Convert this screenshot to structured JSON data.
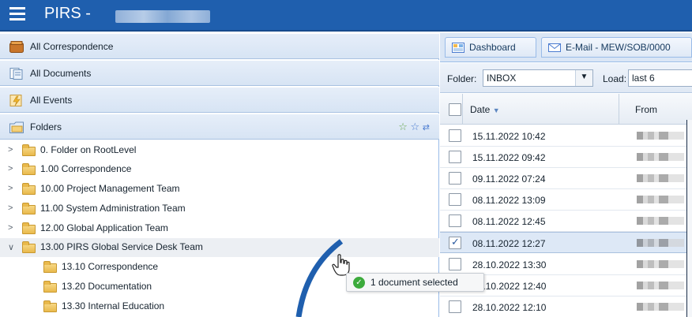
{
  "app": {
    "title": "PIRS",
    "separator": "-",
    "project_name": "First Project"
  },
  "sidebar": {
    "sections": [
      {
        "label": "All Correspondence",
        "icon": "correspondence-icon"
      },
      {
        "label": "All Documents",
        "icon": "documents-icon"
      },
      {
        "label": "All Events",
        "icon": "events-icon"
      },
      {
        "label": "Folders",
        "icon": "folders-icon"
      }
    ],
    "folder_tools": [
      "star-green-icon",
      "star-blue-icon",
      "refresh-icon"
    ],
    "tree": [
      {
        "label": "0. Folder on RootLevel",
        "level": 0,
        "expandable": true
      },
      {
        "label": "1.00 Correspondence",
        "level": 0,
        "expandable": true
      },
      {
        "label": "10.00 Project Management Team",
        "level": 0,
        "expandable": true
      },
      {
        "label": "11.00 System Administration Team",
        "level": 0,
        "expandable": true
      },
      {
        "label": "12.00 Global Application Team",
        "level": 0,
        "expandable": true
      },
      {
        "label": "13.00 PIRS Global Service Desk Team",
        "level": 0,
        "expandable": true,
        "expanded": true,
        "selected": true
      },
      {
        "label": "13.10 Correspondence",
        "level": 1
      },
      {
        "label": "13.20 Documentation",
        "level": 1
      },
      {
        "label": "13.30 Internal Education",
        "level": 1
      }
    ]
  },
  "main": {
    "tabs": [
      {
        "label": "Dashboard",
        "icon": "dashboard-icon"
      },
      {
        "label": "E-Mail - MEW/SOB/0000",
        "icon": "email-icon"
      }
    ],
    "toolbar": {
      "folder_label": "Folder:",
      "folder_value": "INBOX",
      "load_label": "Load:",
      "load_value": "last 6"
    },
    "grid": {
      "columns": [
        "Date",
        "From"
      ],
      "sort": "Date descending",
      "rows": [
        {
          "date": "15.11.2022 10:42",
          "checked": false
        },
        {
          "date": "15.11.2022 09:42",
          "checked": false
        },
        {
          "date": "09.11.2022 07:24",
          "checked": false
        },
        {
          "date": "08.11.2022 13:09",
          "checked": false
        },
        {
          "date": "08.11.2022 12:45",
          "checked": false
        },
        {
          "date": "08.11.2022 12:27",
          "checked": true
        },
        {
          "date": "28.10.2022 13:30",
          "checked": false
        },
        {
          "date": "28.10.2022 12:40",
          "checked": false
        },
        {
          "date": "28.10.2022 12:10",
          "checked": false
        }
      ]
    }
  },
  "drag_tooltip": {
    "text": "1 document selected",
    "icon": "check-circle-icon",
    "color": "#3cab3c"
  },
  "colors": {
    "titlebar": "#1f5fae",
    "accent_arc": "#1f5fae"
  }
}
